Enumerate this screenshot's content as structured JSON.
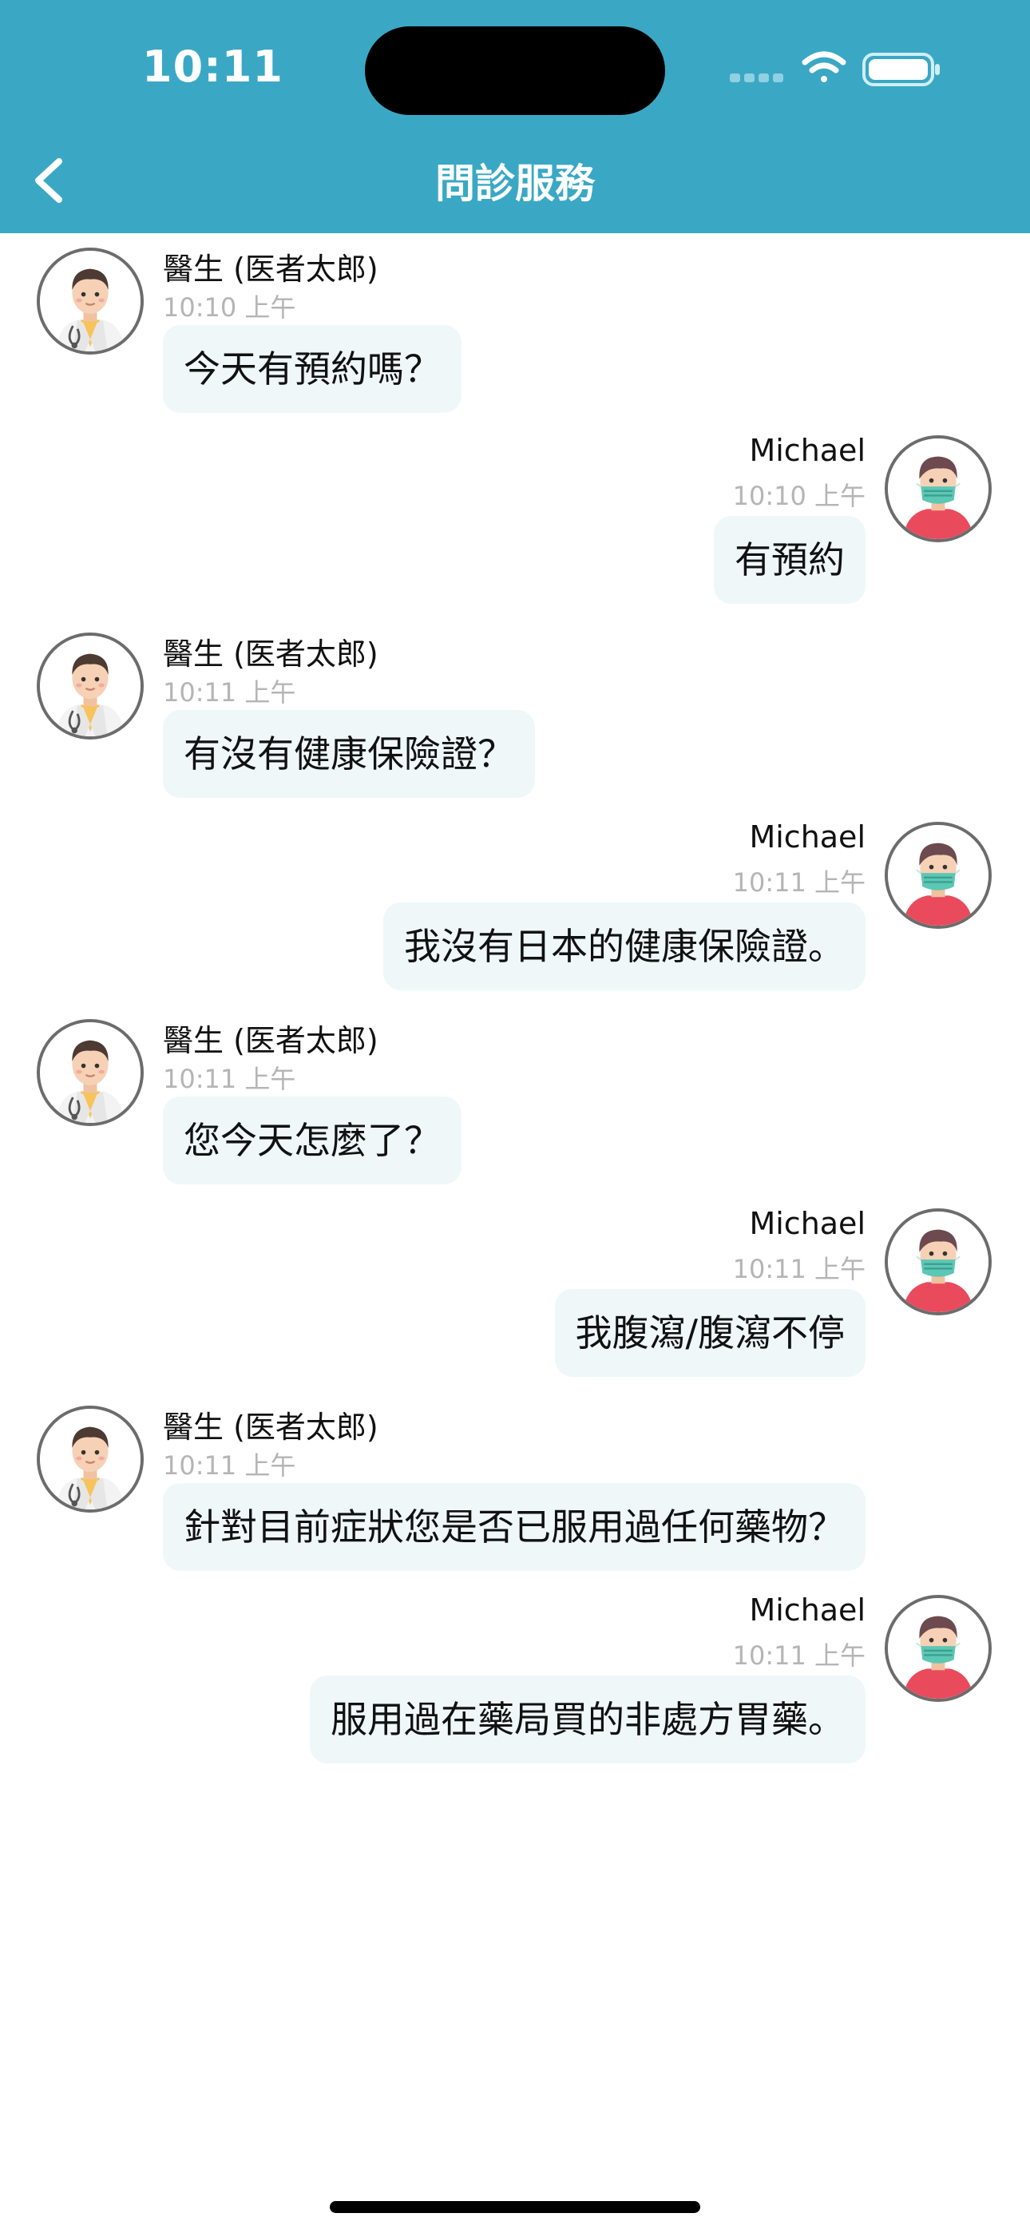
{
  "status_bar": {
    "time": "10:11"
  },
  "nav": {
    "title": "問診服務"
  },
  "messages": [
    {
      "sender": "doctor",
      "name": "醫生 (医者太郎)",
      "time": "10:10 上午",
      "text": "今天有預約嗎？"
    },
    {
      "sender": "patient",
      "name": "Michael",
      "time": "10:10 上午",
      "text": "有預約"
    },
    {
      "sender": "doctor",
      "name": "醫生 (医者太郎)",
      "time": "10:11 上午",
      "text": "有沒有健康保險證？"
    },
    {
      "sender": "patient",
      "name": "Michael",
      "time": "10:11 上午",
      "text": "我沒有日本的健康保險證。"
    },
    {
      "sender": "doctor",
      "name": "醫生 (医者太郎)",
      "time": "10:11 上午",
      "text": "您今天怎麼了？"
    },
    {
      "sender": "patient",
      "name": "Michael",
      "time": "10:11 上午",
      "text": "我腹瀉/腹瀉不停"
    },
    {
      "sender": "doctor",
      "name": "醫生 (医者太郎)",
      "time": "10:11 上午",
      "text": "針對目前症狀您是否已服用過任何藥物？"
    },
    {
      "sender": "patient",
      "name": "Michael",
      "time": "10:11 上午",
      "text": "服用過在藥局買的非處方胃藥。"
    }
  ],
  "icons": {
    "back": "chevron-left-icon",
    "doctor_avatar": "doctor-avatar-icon",
    "patient_avatar": "masked-patient-avatar-icon",
    "signal": "cellular-signal-icon",
    "wifi": "wifi-icon",
    "battery": "battery-icon"
  },
  "colors": {
    "header": "#3aa8c4",
    "bubble": "#eff7f9",
    "timestamp": "#b5b5b5"
  }
}
